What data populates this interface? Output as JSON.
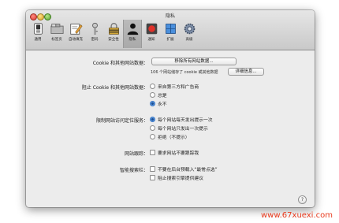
{
  "window": {
    "title": "隐私"
  },
  "toolbar": {
    "tabs": [
      {
        "label": "通用",
        "icon": "switch-icon"
      },
      {
        "label": "标签页",
        "icon": "tabs-icon"
      },
      {
        "label": "自动填充",
        "icon": "pencil-form-icon"
      },
      {
        "label": "密码",
        "icon": "key-icon"
      },
      {
        "label": "安全性",
        "icon": "lock-icon"
      },
      {
        "label": "隐私",
        "icon": "person-silhouette-icon",
        "active": true
      },
      {
        "label": "通知",
        "icon": "notification-icon"
      },
      {
        "label": "扩展",
        "icon": "puzzle-icon"
      },
      {
        "label": "高级",
        "icon": "gear-icon"
      }
    ]
  },
  "cookies": {
    "label": "Cookie 和其他网站数据：",
    "remove_button": "移除所有网站数据...",
    "info_text": "106 个网站储存了 cookie 或其他数据",
    "details_button": "详细信息..."
  },
  "block": {
    "label": "阻止 Cookie 和其他网站数据：",
    "options": [
      "来自第三方和广告商",
      "总是",
      "永不"
    ],
    "selected": 2
  },
  "location": {
    "label": "限制网站访问定位服务：",
    "options": [
      "每个网站每天发出提示一次",
      "每个网站只发出一次提示",
      "拒绝（不提示）"
    ],
    "selected": 0
  },
  "tracking": {
    "label": "网站跟踪：",
    "option": "要求网站不要跟踪我"
  },
  "smart_search": {
    "label": "智能搜索栏：",
    "options": [
      "不要在后台预载入“最常点选”",
      "阻止搜索引擎提供建议"
    ]
  },
  "help": {
    "label": "?"
  },
  "watermark": "www.67xuexi.com"
}
